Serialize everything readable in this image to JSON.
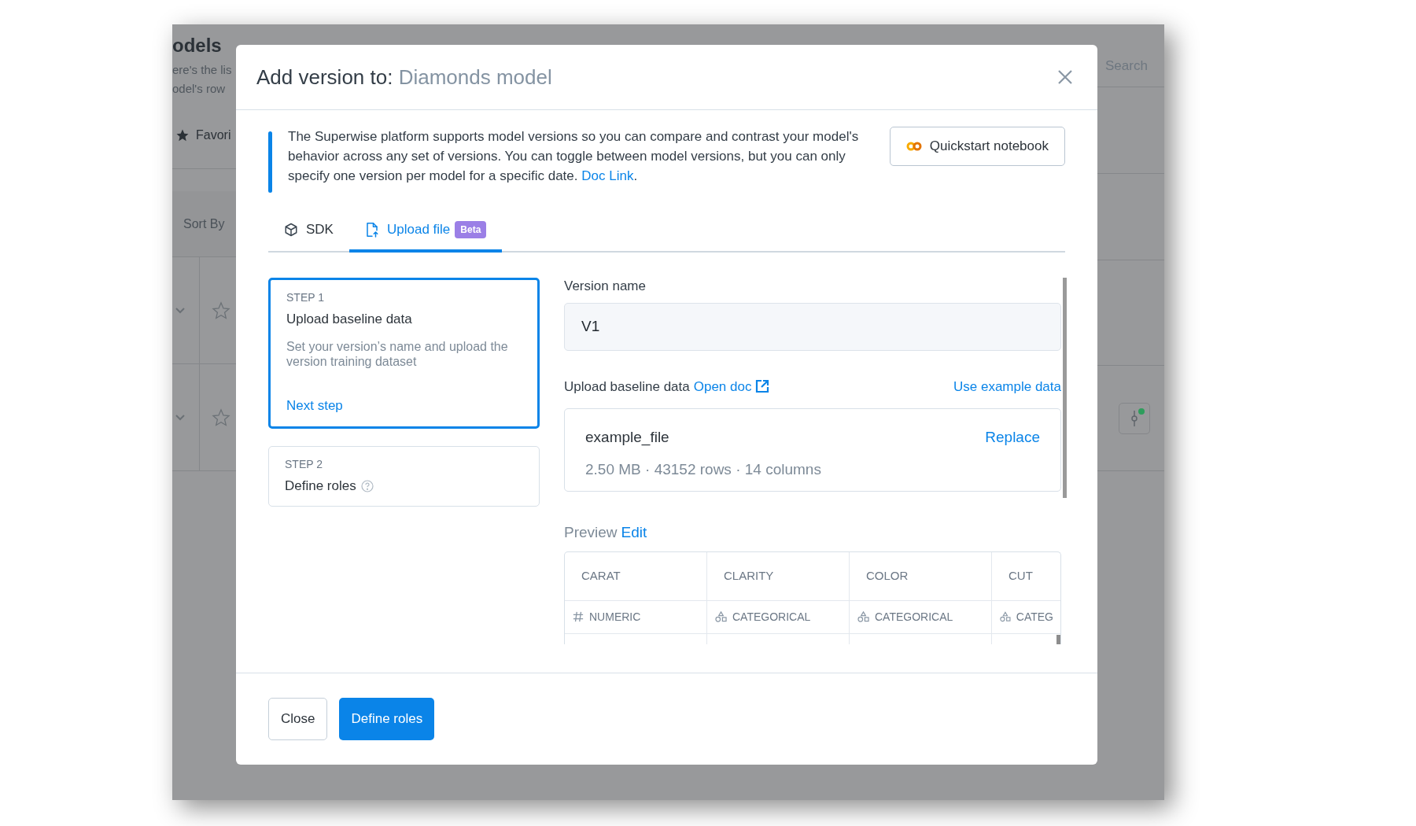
{
  "background": {
    "title": "odels",
    "description_lines": [
      "ere's the lis",
      "odel's row"
    ],
    "favorites_label": "Favori",
    "sort_label": "Sort By",
    "search_placeholder": "Search"
  },
  "dialog": {
    "title_prefix": "Add version to:",
    "title_model": "Diamonds model",
    "info": {
      "text": "The Superwise platform supports model versions so you can compare and contrast your model's behavior across any set of versions. You can toggle between model versions, but you can only specify one version per model for a specific date.",
      "link": "Doc Link",
      "after": "."
    },
    "quickstart_button": "Quickstart notebook",
    "tabs": [
      {
        "label": "SDK",
        "kind": "cube",
        "selected": false
      },
      {
        "label": "Upload file",
        "kind": "file-upload",
        "badge": "Beta",
        "selected": true
      }
    ],
    "steps": [
      {
        "step": "STEP 1",
        "title": "Upload baseline data",
        "description": "Set your version’s name and upload the version training dataset",
        "action": "Next step",
        "selected": true
      },
      {
        "step": "STEP 2",
        "title": "Define roles",
        "help": true,
        "selected": false
      }
    ],
    "form": {
      "version_label": "Version name",
      "version_value": "V1",
      "upload_label": "Upload baseline data",
      "open_doc_link": "Open doc",
      "example_link": "Use example data",
      "file": {
        "name": "example_file",
        "meta": "2.50 MB · 43152 rows · 14 columns",
        "action": "Replace"
      },
      "preview_label": "Preview",
      "preview_edit": "Edit",
      "columns": [
        {
          "name": "CARAT",
          "type": "NUMERIC",
          "kind": "numeric"
        },
        {
          "name": "CLARITY",
          "type": "CATEGORICAL",
          "kind": "categorical"
        },
        {
          "name": "COLOR",
          "type": "CATEGORICAL",
          "kind": "categorical"
        },
        {
          "name": "CUT",
          "type": "CATEG",
          "kind": "categorical"
        }
      ]
    },
    "footer": {
      "close_button": "Close",
      "primary_button": "Define roles"
    }
  }
}
